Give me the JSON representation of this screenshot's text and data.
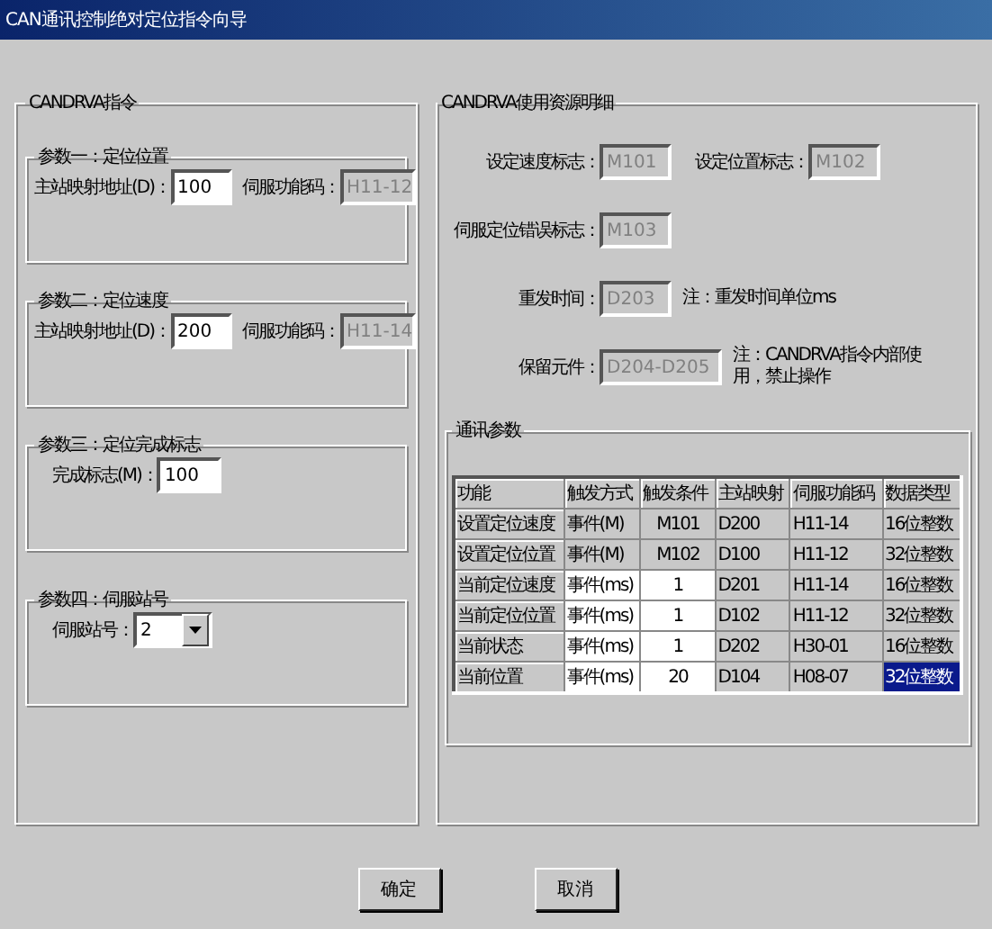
{
  "window": {
    "title": "CAN通讯控制绝对定位指令向导"
  },
  "instruction_group": {
    "title": "CANDRVA指令",
    "params": [
      {
        "kind": "text_pair",
        "title": "参数一：定位位置",
        "label": "主站映射地址(D)：",
        "value": "100",
        "code_label": "伺服功能码：",
        "code_value": "H11-12",
        "code_disabled": true
      },
      {
        "kind": "text_pair",
        "title": "参数二：定位速度",
        "label": "主站映射地址(D)：",
        "value": "200",
        "code_label": "伺服功能码：",
        "code_value": "H11-14",
        "code_disabled": true
      },
      {
        "kind": "text",
        "title": "参数三：定位完成标志",
        "label": "完成标志(M)：",
        "value": "100"
      },
      {
        "kind": "combo",
        "title": "参数四：伺服站号",
        "label": "伺服站号：",
        "value": "2"
      }
    ]
  },
  "resources_group": {
    "title": "CANDRVA使用资源明细",
    "speed_flag": {
      "label": "设定速度标志：",
      "value": "M101",
      "disabled": true
    },
    "position_flag": {
      "label": "设定位置标志：",
      "value": "M102",
      "disabled": true
    },
    "error_flag": {
      "label": "伺服定位错误标志：",
      "value": "M103",
      "disabled": true
    },
    "resend_time": {
      "label": "重发时间：",
      "value": "D203",
      "disabled": true,
      "note": "注：重发时间单位ms"
    },
    "reserved": {
      "label": "保留元件：",
      "value": "D204-D205",
      "disabled": true,
      "note": "注：CANDRVA指令内部使用，禁止操作"
    },
    "comm_group": {
      "title": "通讯参数",
      "columns": [
        "功能",
        "触发方式",
        "触发条件",
        "主站映射",
        "伺服功能码",
        "数据类型"
      ],
      "rows": [
        {
          "function": "设置定位速度",
          "trigger_mode": "事件(M)",
          "trigger_condition": "M101",
          "master_map": "D200",
          "servo_code": "H11-14",
          "data_type": "16位整数",
          "editable": false,
          "selected": false
        },
        {
          "function": "设置定位位置",
          "trigger_mode": "事件(M)",
          "trigger_condition": "M102",
          "master_map": "D100",
          "servo_code": "H11-12",
          "data_type": "32位整数",
          "editable": false,
          "selected": false
        },
        {
          "function": "当前定位速度",
          "trigger_mode": "事件(ms)",
          "trigger_condition": "1",
          "master_map": "D201",
          "servo_code": "H11-14",
          "data_type": "16位整数",
          "editable": true,
          "selected": false
        },
        {
          "function": "当前定位位置",
          "trigger_mode": "事件(ms)",
          "trigger_condition": "1",
          "master_map": "D102",
          "servo_code": "H11-12",
          "data_type": "32位整数",
          "editable": true,
          "selected": false
        },
        {
          "function": "当前状态",
          "trigger_mode": "事件(ms)",
          "trigger_condition": "1",
          "master_map": "D202",
          "servo_code": "H30-01",
          "data_type": "16位整数",
          "editable": true,
          "selected": false
        },
        {
          "function": "当前位置",
          "trigger_mode": "事件(ms)",
          "trigger_condition": "20",
          "master_map": "D104",
          "servo_code": "H08-07",
          "data_type": "32位整数",
          "editable": true,
          "selected": true
        }
      ]
    }
  },
  "buttons": [
    "确定",
    "取消"
  ]
}
